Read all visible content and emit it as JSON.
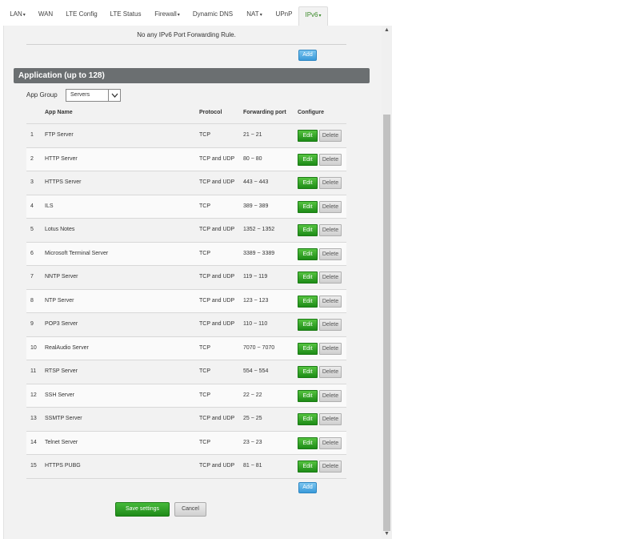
{
  "nav": {
    "tabs": [
      {
        "label": "LAN",
        "caret": "▾"
      },
      {
        "label": "WAN",
        "caret": ""
      },
      {
        "label": "LTE Config",
        "caret": ""
      },
      {
        "label": "LTE Status",
        "caret": ""
      },
      {
        "label": "Firewall",
        "caret": "▾"
      },
      {
        "label": "Dynamic DNS",
        "caret": ""
      },
      {
        "label": "NAT",
        "caret": "▾"
      },
      {
        "label": "UPnP",
        "caret": ""
      },
      {
        "label": "IPv6",
        "caret": "▾"
      }
    ],
    "active_index": 8
  },
  "ipv6_forwarding": {
    "empty_message": "No any IPv6 Port Forwarding Rule.",
    "add_label": "Add"
  },
  "application": {
    "header": "Application (up to 128)",
    "app_group_label": "App Group",
    "app_group_value": "Servers",
    "columns": {
      "app_name": "App Name",
      "protocol": "Protocol",
      "forwarding_port": "Forwarding port",
      "configure": "Configure"
    },
    "rows": [
      {
        "num": "1",
        "name": "FTP Server",
        "protocol": "TCP",
        "port": "21 ~ 21"
      },
      {
        "num": "2",
        "name": "HTTP Server",
        "protocol": "TCP and UDP",
        "port": "80 ~ 80"
      },
      {
        "num": "3",
        "name": "HTTPS Server",
        "protocol": "TCP and UDP",
        "port": "443 ~ 443"
      },
      {
        "num": "4",
        "name": "ILS",
        "protocol": "TCP",
        "port": "389 ~ 389"
      },
      {
        "num": "5",
        "name": "Lotus Notes",
        "protocol": "TCP and UDP",
        "port": "1352 ~ 1352"
      },
      {
        "num": "6",
        "name": "Microsoft Terminal Server",
        "protocol": "TCP",
        "port": "3389 ~ 3389"
      },
      {
        "num": "7",
        "name": "NNTP Server",
        "protocol": "TCP and UDP",
        "port": "119 ~ 119"
      },
      {
        "num": "8",
        "name": "NTP Server",
        "protocol": "TCP and UDP",
        "port": "123 ~ 123"
      },
      {
        "num": "9",
        "name": "POP3 Server",
        "protocol": "TCP and UDP",
        "port": "110 ~ 110"
      },
      {
        "num": "10",
        "name": "RealAudio Server",
        "protocol": "TCP",
        "port": "7070 ~ 7070"
      },
      {
        "num": "11",
        "name": "RTSP Server",
        "protocol": "TCP",
        "port": "554 ~ 554"
      },
      {
        "num": "12",
        "name": "SSH Server",
        "protocol": "TCP",
        "port": "22 ~ 22"
      },
      {
        "num": "13",
        "name": "SSMTP Server",
        "protocol": "TCP and UDP",
        "port": "25 ~ 25"
      },
      {
        "num": "14",
        "name": "Telnet Server",
        "protocol": "TCP",
        "port": "23 ~ 23"
      },
      {
        "num": "15",
        "name": "HTTPS PUBG",
        "protocol": "TCP and UDP",
        "port": "81 ~ 81"
      }
    ],
    "edit_label": "Edit",
    "delete_label": "Delete",
    "add_label": "Add"
  },
  "footer": {
    "save_label": "Save settings",
    "cancel_label": "Cancel"
  },
  "icons": {
    "scroll_up": "triangle-up-icon",
    "scroll_down": "triangle-down-icon",
    "select_arrow": "chevron-down-icon"
  },
  "colors": {
    "active_tab_text": "#3b8a2a",
    "section_header_bg": "#6b6f71",
    "edit_button": "#2a9a22",
    "add_button": "#3a9ad9"
  }
}
